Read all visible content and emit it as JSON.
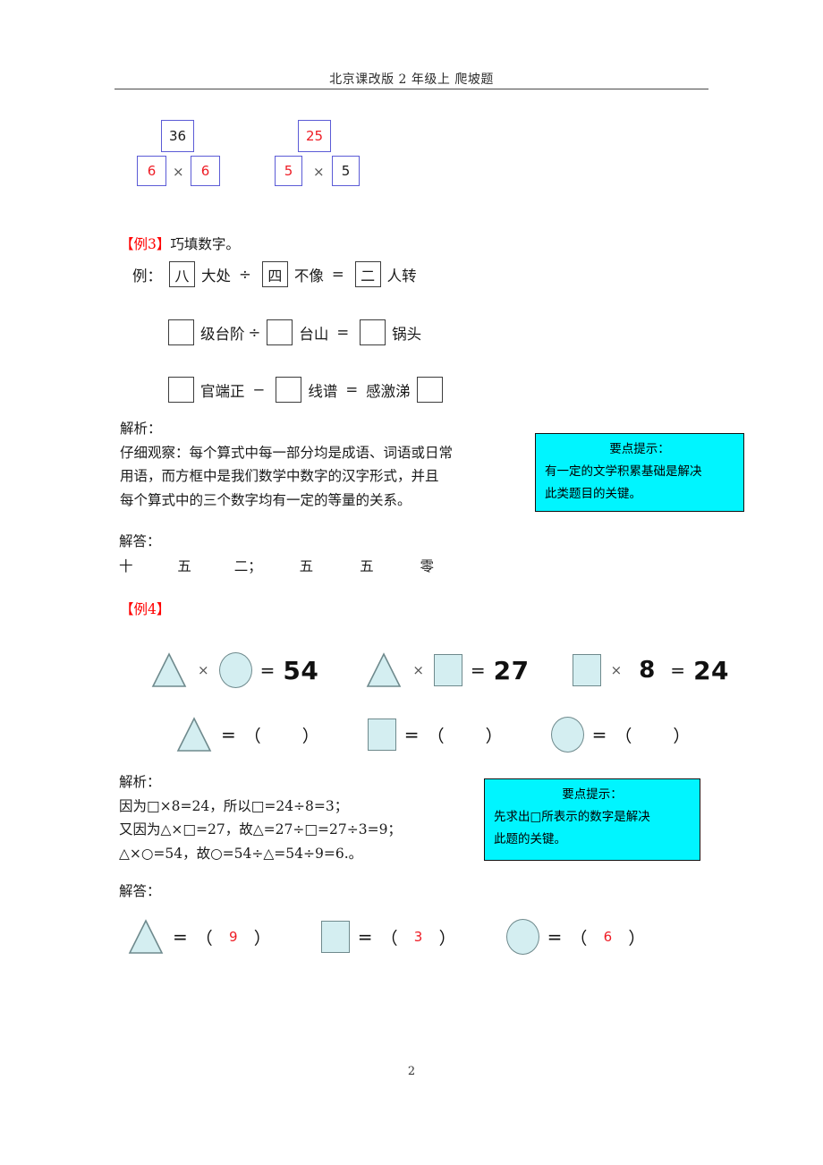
{
  "header": {
    "title": "北京课改版 2 年级上 爬坡题"
  },
  "top_diagram": {
    "group1": {
      "top_value": "36",
      "left_value": "6",
      "operator": "×",
      "right_value": "6"
    },
    "group2": {
      "top_value": "25",
      "left_value": "5",
      "operator": "×",
      "right_value": "5"
    }
  },
  "example3": {
    "label_open": "【例",
    "label_num": "3",
    "label_close": "】",
    "title": "巧填数字。",
    "sample": {
      "lead": "例：",
      "box1": "八",
      "word1": "大处",
      "op1": "÷",
      "box2": "四",
      "word2": "不像",
      "op2": "=",
      "box3": "二",
      "word3": "人转"
    },
    "q1": {
      "box1": "",
      "word1": "级台阶",
      "op1": "÷",
      "box2": "",
      "word2": "台山",
      "op2": "=",
      "box3": "",
      "word3": "锅头"
    },
    "q2": {
      "box1": "",
      "word1": "官端正",
      "op1": "−",
      "box2": "",
      "word2": "线谱",
      "op2": "=",
      "word3": "感激涕",
      "box3": ""
    },
    "analysis_label": "解析：",
    "analysis_lines": [
      "仔细观察：每个算式中每一部分均是成语、词语或日常",
      "用语，而方框中是我们数学中数字的汉字形式，并且",
      "每个算式中的三个数字均有一定的等量的关系。"
    ],
    "hint": {
      "title": "要点提示：",
      "line1": "有一定的文学积累基础是解决",
      "line2": "此类题目的关键。"
    },
    "answer_label": "解答：",
    "answer_values": [
      "十",
      "五",
      "二；",
      "五",
      "五",
      "零"
    ]
  },
  "example4": {
    "label_open": "【例",
    "label_num": "4",
    "label_close": "】",
    "equations": [
      {
        "left_shape": "triangle",
        "operator": "×",
        "right_shape": "circle",
        "equals": "=",
        "result": "54"
      },
      {
        "left_shape": "triangle",
        "operator": "×",
        "right_shape": "square",
        "equals": "=",
        "result": "27"
      },
      {
        "left_shape": "square",
        "operator": "×",
        "right_number": "8",
        "equals": "=",
        "result": "24"
      }
    ],
    "question_blanks": [
      {
        "shape": "triangle",
        "equals": "=",
        "open": "（",
        "value": "",
        "close": "）"
      },
      {
        "shape": "square",
        "equals": "=",
        "open": "（",
        "value": "",
        "close": "）"
      },
      {
        "shape": "circle",
        "equals": "=",
        "open": "（",
        "value": "",
        "close": "）"
      }
    ],
    "analysis_label": "解析：",
    "analysis_lines": [
      "因为□×8=24，所以□=24÷8=3；",
      "又因为△×□=27，故△=27÷□=27÷3=9；",
      "△×○=54，故○=54÷△=54÷9=6.。"
    ],
    "hint": {
      "title": "要点提示：",
      "line1": "先求出□所表示的数字是解决",
      "line2": "此题的关键。"
    },
    "answer_label": "解答：",
    "answer_blanks": [
      {
        "shape": "triangle",
        "equals": "=",
        "open": "（",
        "value": "9",
        "close": "）"
      },
      {
        "shape": "square",
        "equals": "=",
        "open": "（",
        "value": "3",
        "close": "）"
      },
      {
        "shape": "circle",
        "equals": "=",
        "open": "（",
        "value": "6",
        "close": "）"
      }
    ]
  },
  "footer": {
    "page_number": "2"
  },
  "colors": {
    "answer_red": "#ee1c25",
    "example_red": "#ff0000",
    "box_blue": "#5b5bd6",
    "hint_cyan": "#00f5ff",
    "shape_fill": "#d4eef1",
    "shape_stroke": "#6f8a8d"
  }
}
